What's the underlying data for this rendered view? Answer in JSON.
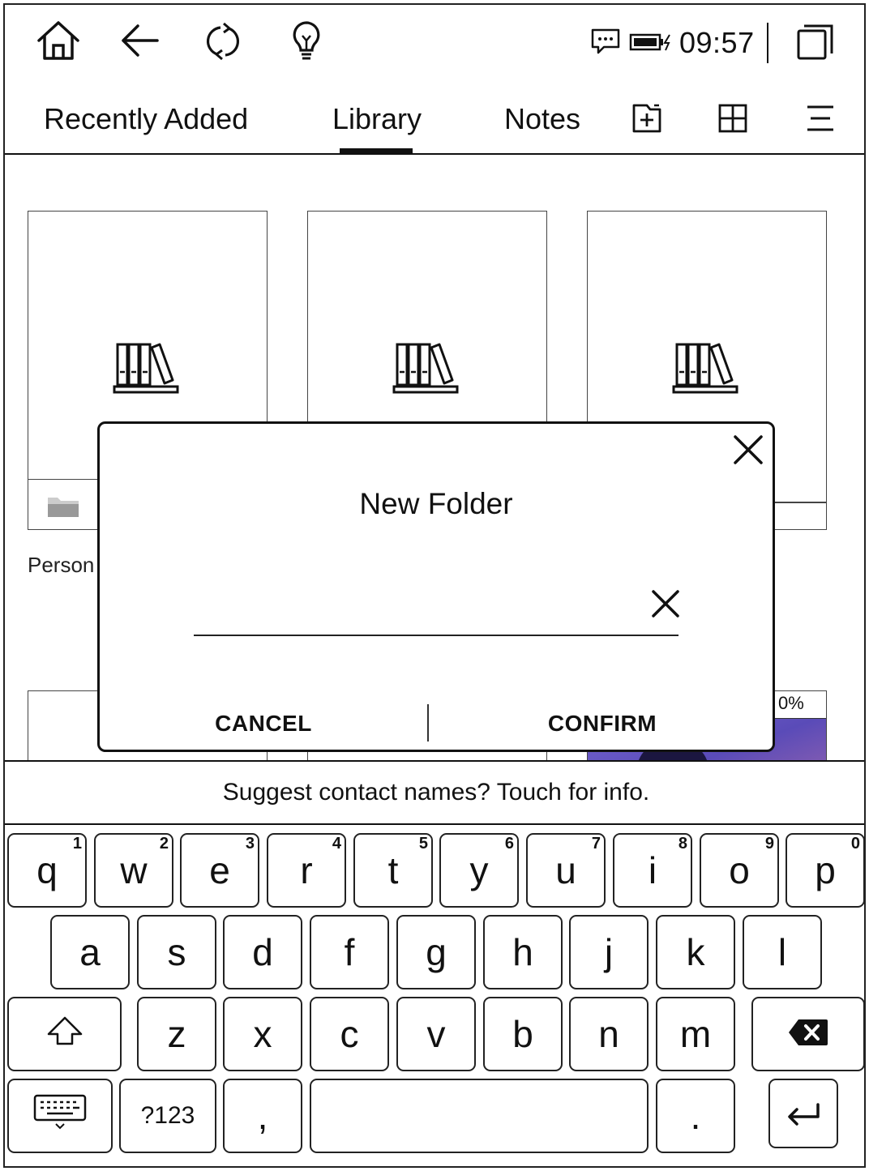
{
  "status_bar": {
    "time": "09:57",
    "icons": [
      "home-icon",
      "back-arrow-icon",
      "sync-icon",
      "lightbulb-icon",
      "message-icon",
      "battery-charging-icon",
      "multiwindow-icon"
    ]
  },
  "tabs": [
    {
      "label": "Recently Added",
      "active": false
    },
    {
      "label": "Library",
      "active": true
    },
    {
      "label": "Notes",
      "active": false
    }
  ],
  "toolbar_icons": [
    "new-folder-icon",
    "grid-view-icon",
    "menu-icon"
  ],
  "library": {
    "folder_caption_partial": "Person",
    "progress_badge_partial": "0%",
    "cover_icon": "bookshelf-icon",
    "folder_icon": "folder-icon"
  },
  "dialog": {
    "title": "New Folder",
    "input_value": "",
    "cancel_label": "CANCEL",
    "confirm_label": "CONFIRM"
  },
  "keyboard": {
    "suggestion": "Suggest contact names? Touch for info.",
    "row1": [
      {
        "key": "q",
        "hint": "1"
      },
      {
        "key": "w",
        "hint": "2"
      },
      {
        "key": "e",
        "hint": "3"
      },
      {
        "key": "r",
        "hint": "4"
      },
      {
        "key": "t",
        "hint": "5"
      },
      {
        "key": "y",
        "hint": "6"
      },
      {
        "key": "u",
        "hint": "7"
      },
      {
        "key": "i",
        "hint": "8"
      },
      {
        "key": "o",
        "hint": "9"
      },
      {
        "key": "p",
        "hint": "0"
      }
    ],
    "row2": [
      "a",
      "s",
      "d",
      "f",
      "g",
      "h",
      "j",
      "k",
      "l"
    ],
    "row3": [
      "z",
      "x",
      "c",
      "v",
      "b",
      "n",
      "m"
    ],
    "symbols_label": "?123",
    "comma": ",",
    "period": "."
  }
}
